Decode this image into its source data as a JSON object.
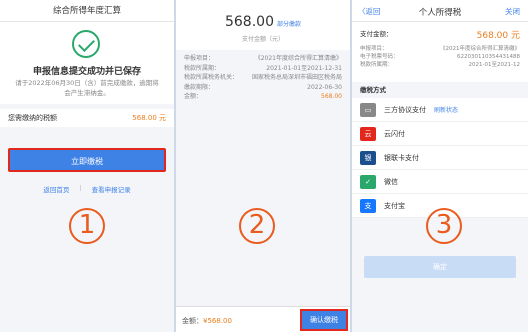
{
  "panel1": {
    "title": "综合所得年度汇算",
    "message": "申报信息提交成功并已保存",
    "note": "请于2022年06月30日（含）前完成缴款，逾期将会产生滞纳金。",
    "tax_label": "您需缴纳的税额",
    "tax_value": "568.00 元",
    "pay_button": "立即缴税",
    "link_home": "返回首页",
    "link_records": "查看申报记录",
    "step": "1"
  },
  "panel2": {
    "amount": "568.00",
    "partial_link": "部分缴款",
    "amount_label": "支付金额（元）",
    "rows": [
      {
        "k": "申报项目：",
        "v": "《2021年度综合所得汇算清缴》"
      },
      {
        "k": "税款所属期：",
        "v": "2021-01-01至2021-12-31"
      },
      {
        "k": "税款所属税务机关：",
        "v": "国家税务总局深圳市福田区税务局"
      },
      {
        "k": "缴款期限：",
        "v": "2022-06-30"
      },
      {
        "k": "金额：",
        "v": "568.00"
      }
    ],
    "bottom_label": "金额：",
    "bottom_amount": "¥568.00",
    "confirm_button": "确认缴税",
    "step": "2"
  },
  "panel3": {
    "back": "〈返回",
    "title": "个人所得税",
    "close": "关闭",
    "pay_amount_label": "支付金额：",
    "pay_amount": "568.00 元",
    "details": [
      {
        "k": "申报项目：",
        "v": "《2021年度综合所得汇算清缴》"
      },
      {
        "k": "电子税票号码：",
        "v": "622030110354431488"
      },
      {
        "k": "税款所属期：",
        "v": "2021-01至2021-12"
      }
    ],
    "section_title": "缴税方式",
    "methods": [
      {
        "label": "三方协议支付",
        "link": "刷新状态",
        "color": "#888888",
        "icon": "bank-card-icon"
      },
      {
        "label": "云闪付",
        "link": "",
        "color": "#e2271c",
        "icon": "unionpay-icon"
      },
      {
        "label": "银联卡支付",
        "link": "",
        "color": "#1a4e8c",
        "icon": "union-card-icon"
      },
      {
        "label": "微信",
        "link": "",
        "color": "#2aa86c",
        "icon": "wechat-check-icon"
      },
      {
        "label": "支付宝",
        "link": "",
        "color": "#1677ff",
        "icon": "alipay-icon"
      }
    ],
    "pay_button": "确定",
    "step": "3"
  }
}
